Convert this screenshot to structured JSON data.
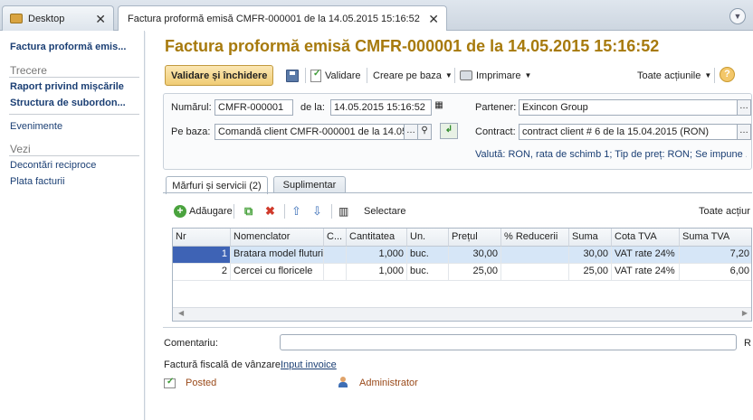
{
  "tabs": {
    "desktop": "Desktop",
    "document": "Factura proformă emisă CMFR-000001 de la 14.05.2015 15:16:52",
    "close": "✕"
  },
  "sidebar": {
    "title": "Factura proformă emis...",
    "group_trecere": "Trecere",
    "links1": [
      "Raport privind mișcările",
      "Structura de subordon..."
    ],
    "evenimente": "Evenimente",
    "group_vezi": "Vezi",
    "links2": [
      "Decontări reciproce",
      "Plata facturii"
    ]
  },
  "header": {
    "title": "Factura proformă emisă CMFR-000001 de la 14.05.2015 15:16:52"
  },
  "toolbar": {
    "save_close": "Validare și închidere",
    "validate": "Validare",
    "create_based": "Creare pe baza",
    "print": "Imprimare",
    "all_actions": "Toate acțiunile",
    "help": "?"
  },
  "form": {
    "number_label": "Numărul:",
    "number_value": "CMFR-000001",
    "date_label": "de la:",
    "date_value": "14.05.2015 15:16:52",
    "base_label": "Pe baza:",
    "base_value": "Comandă client CMFR-000001 de la 14.05.",
    "partner_label": "Partener:",
    "partner_value": "Exincon Group",
    "contract_label": "Contract:",
    "contract_value": "contract client # 6 de la 15.04.2015 (RON)",
    "currency_info": "Valută: RON, rata de schimb 1; Tip de preț: RON; Se impune ..."
  },
  "panel_tabs": {
    "goods": "Mărfuri și servicii (2)",
    "extra": "Suplimentar"
  },
  "table_toolbar": {
    "add": "Adăugare",
    "select": "Selectare",
    "all_actions": "Toate acțiur"
  },
  "table": {
    "columns": [
      "Nr",
      "Nomenclator",
      "C...",
      "Cantitatea",
      "Un.",
      "Prețul",
      "% Reducerii",
      "Suma",
      "Cota TVA",
      "Suma TVA"
    ],
    "rows": [
      [
        "1",
        "Bratara model fluturi",
        "",
        "1,000",
        "buc.",
        "30,00",
        "",
        "30,00",
        "VAT rate 24%",
        "7,20"
      ],
      [
        "2",
        "Cercei cu floricele",
        "",
        "1,000",
        "buc.",
        "25,00",
        "",
        "25,00",
        "VAT rate 24%",
        "6,00"
      ]
    ]
  },
  "footer": {
    "comment_label": "Comentariu:",
    "comment_tail": "R",
    "fiscal_label": "Factură fiscală de vânzare:",
    "fiscal_link": "Input invoice",
    "status": "Posted",
    "user": "Administrator"
  }
}
